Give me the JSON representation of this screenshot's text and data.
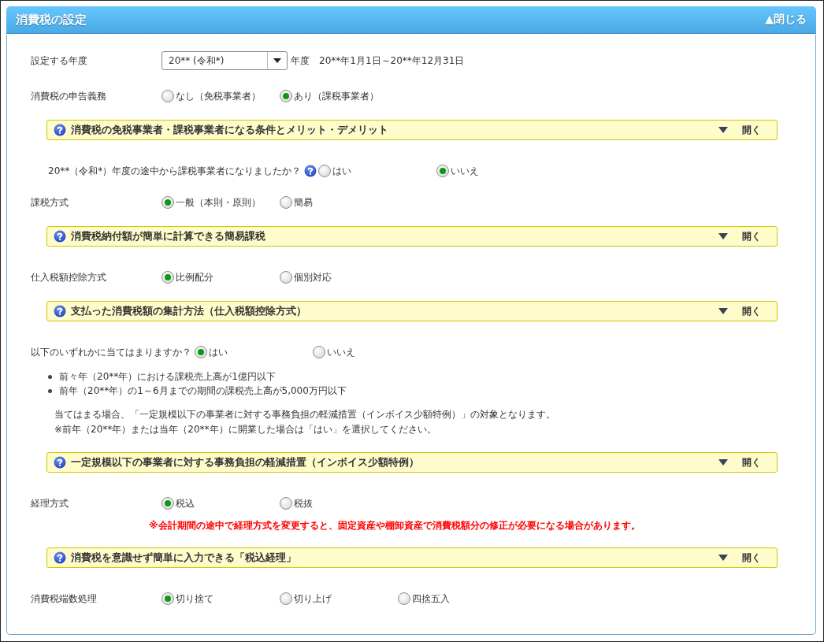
{
  "panel": {
    "title": "消費税の設定",
    "collapse_button": "▲閉じる"
  },
  "items": [
    {
      "kind": "year",
      "label": "設定する年度",
      "select_value": "20** (令和*)",
      "suffix": "年度",
      "period": "20**年1月1日～20**年12月31日"
    },
    {
      "kind": "radio",
      "label": "消費税の申告義務",
      "options": [
        {
          "label": "なし（免税事業者）",
          "selected": false
        },
        {
          "label": "あり（課税事業者）",
          "selected": true
        }
      ]
    },
    {
      "kind": "help",
      "title": "消費税の免税事業者・課税事業者になる条件とメリット・デメリット",
      "toggle": "開く"
    },
    {
      "kind": "subquestion",
      "question": "20**（令和*）年度の途中から課税事業者になりましたか？",
      "options": [
        {
          "label": "はい",
          "selected": false
        },
        {
          "label": "いいえ",
          "selected": true
        }
      ]
    },
    {
      "kind": "radio",
      "label": "課税方式",
      "options": [
        {
          "label": "一般（本則・原則）",
          "selected": true
        },
        {
          "label": "簡易",
          "selected": false
        }
      ]
    },
    {
      "kind": "help",
      "title": "消費税納付額が簡単に計算できる簡易課税",
      "toggle": "開く"
    },
    {
      "kind": "radio",
      "label": "仕入税額控除方式",
      "options": [
        {
          "label": "比例配分",
          "selected": true
        },
        {
          "label": "個別対応",
          "selected": false
        }
      ]
    },
    {
      "kind": "help",
      "title": "支払った消費税額の集計方法（仕入税額控除方式）",
      "toggle": "開く"
    },
    {
      "kind": "question",
      "question": "以下のいずれかに当てはまりますか？",
      "options": [
        {
          "label": "はい",
          "selected": true
        },
        {
          "label": "いいえ",
          "selected": false
        }
      ]
    },
    {
      "kind": "bullets",
      "items": [
        "前々年（20**年）における課税売上高が1億円以下",
        "前年（20**年）の1～6月までの期間の課税売上高が5,000万円以下"
      ]
    },
    {
      "kind": "note",
      "lines": [
        "当てはまる場合、「一定規模以下の事業者に対する事務負担の軽減措置（インボイス少額特例）」の対象となります。",
        "※前年（20**年）または当年（20**年）に開業した場合は「はい」を選択してください。"
      ]
    },
    {
      "kind": "help",
      "title": "一定規模以下の事業者に対する事務負担の軽減措置（インボイス少額特例）",
      "toggle": "開く"
    },
    {
      "kind": "radio",
      "label": "経理方式",
      "options": [
        {
          "label": "税込",
          "selected": true
        },
        {
          "label": "税抜",
          "selected": false
        }
      ]
    },
    {
      "kind": "warning",
      "text": "※会計期間の途中で経理方式を変更すると、固定資産や棚卸資産で消費税額分の修正が必要になる場合があります。"
    },
    {
      "kind": "help",
      "title": "消費税を意識せず簡単に入力できる「税込経理」",
      "toggle": "開く"
    },
    {
      "kind": "radio",
      "label": "消費税端数処理",
      "options": [
        {
          "label": "切り捨て",
          "selected": true
        },
        {
          "label": "切り上げ",
          "selected": false
        },
        {
          "label": "四捨五入",
          "selected": false
        }
      ]
    }
  ]
}
